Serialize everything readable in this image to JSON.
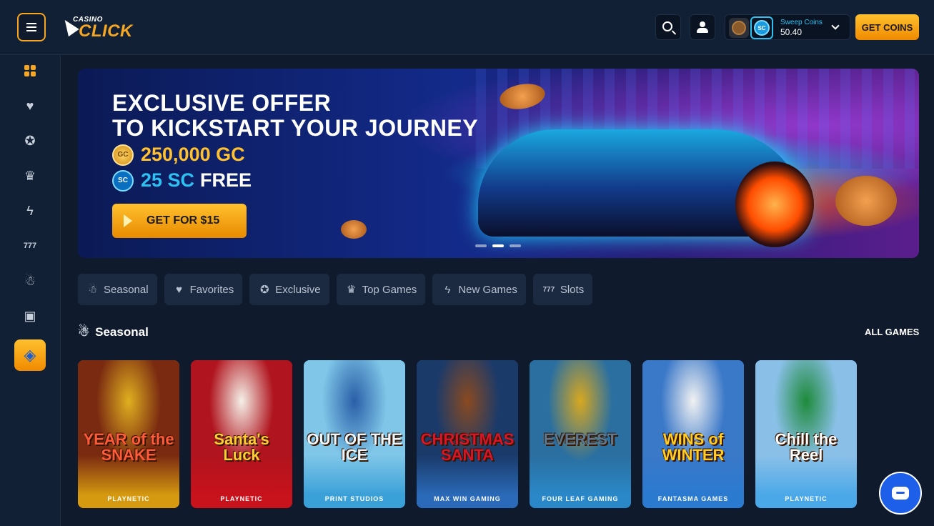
{
  "header": {
    "logo_small": "CASINO",
    "logo_big": "CLICK",
    "wallet": {
      "label": "Sweep Coins",
      "amount": "50.40",
      "sc_badge": "SC"
    },
    "get_coins": "GET COINS"
  },
  "banner": {
    "line1": "EXCLUSIVE OFFER",
    "line2": "TO KICKSTART YOUR JOURNEY",
    "gc_badge": "GC",
    "gc_amount": "250,000 GC",
    "sc_badge": "SC",
    "sc_amount": "25 SC",
    "sc_free": "FREE",
    "cta": "GET FOR $15",
    "active_slide": 2,
    "slide_count": 3
  },
  "categories": [
    {
      "label": "Seasonal",
      "icon": "gingerbread-icon"
    },
    {
      "label": "Favorites",
      "icon": "heart-icon"
    },
    {
      "label": "Exclusive",
      "icon": "award-icon"
    },
    {
      "label": "Top Games",
      "icon": "trophy-icon"
    },
    {
      "label": "New Games",
      "icon": "lightning-icon"
    },
    {
      "label": "Slots",
      "icon": "slots-777-icon"
    }
  ],
  "section": {
    "title": "Seasonal",
    "all_games": "ALL GAMES"
  },
  "games": [
    {
      "title": "YEAR of the SNAKE",
      "provider": "PLAYNETIC",
      "bg": "#7a2a10",
      "accent": "#e0b020",
      "text": "#ff5a3a",
      "band": "#d69a10"
    },
    {
      "title": "Santa's Luck",
      "provider": "PLAYNETIC",
      "bg": "#b0141e",
      "accent": "#f5f0e8",
      "text": "#ffcc33",
      "band": "#c8121c"
    },
    {
      "title": "OUT OF THE ICE",
      "provider": "PRINT STUDIOS",
      "bg": "#7fc6e8",
      "accent": "#2a5fa8",
      "text": "#e6f7ff",
      "band": "#3aa0d8"
    },
    {
      "title": "CHRISTMAS SANTA",
      "provider": "MAX WIN GAMING",
      "bg": "#1a3a6a",
      "accent": "#8a4a20",
      "text": "#d8162a",
      "band": "#2a6ab8"
    },
    {
      "title": "EVEREST",
      "provider": "FOUR LEAF GAMING",
      "bg": "#2a6fa0",
      "accent": "#d8a820",
      "text": "#5a7890",
      "band": "#2a88c8"
    },
    {
      "title": "WINS of WINTER",
      "provider": "FANTASMA GAMES",
      "bg": "#3a78c8",
      "accent": "#f2f2f2",
      "text": "#ffcc22",
      "band": "#2a7ad0"
    },
    {
      "title": "Chill the Reel",
      "provider": "PLAYNETIC",
      "bg": "#8ac0e8",
      "accent": "#1e8a3a",
      "text": "#ffffff",
      "band": "#4aa8e8"
    }
  ]
}
